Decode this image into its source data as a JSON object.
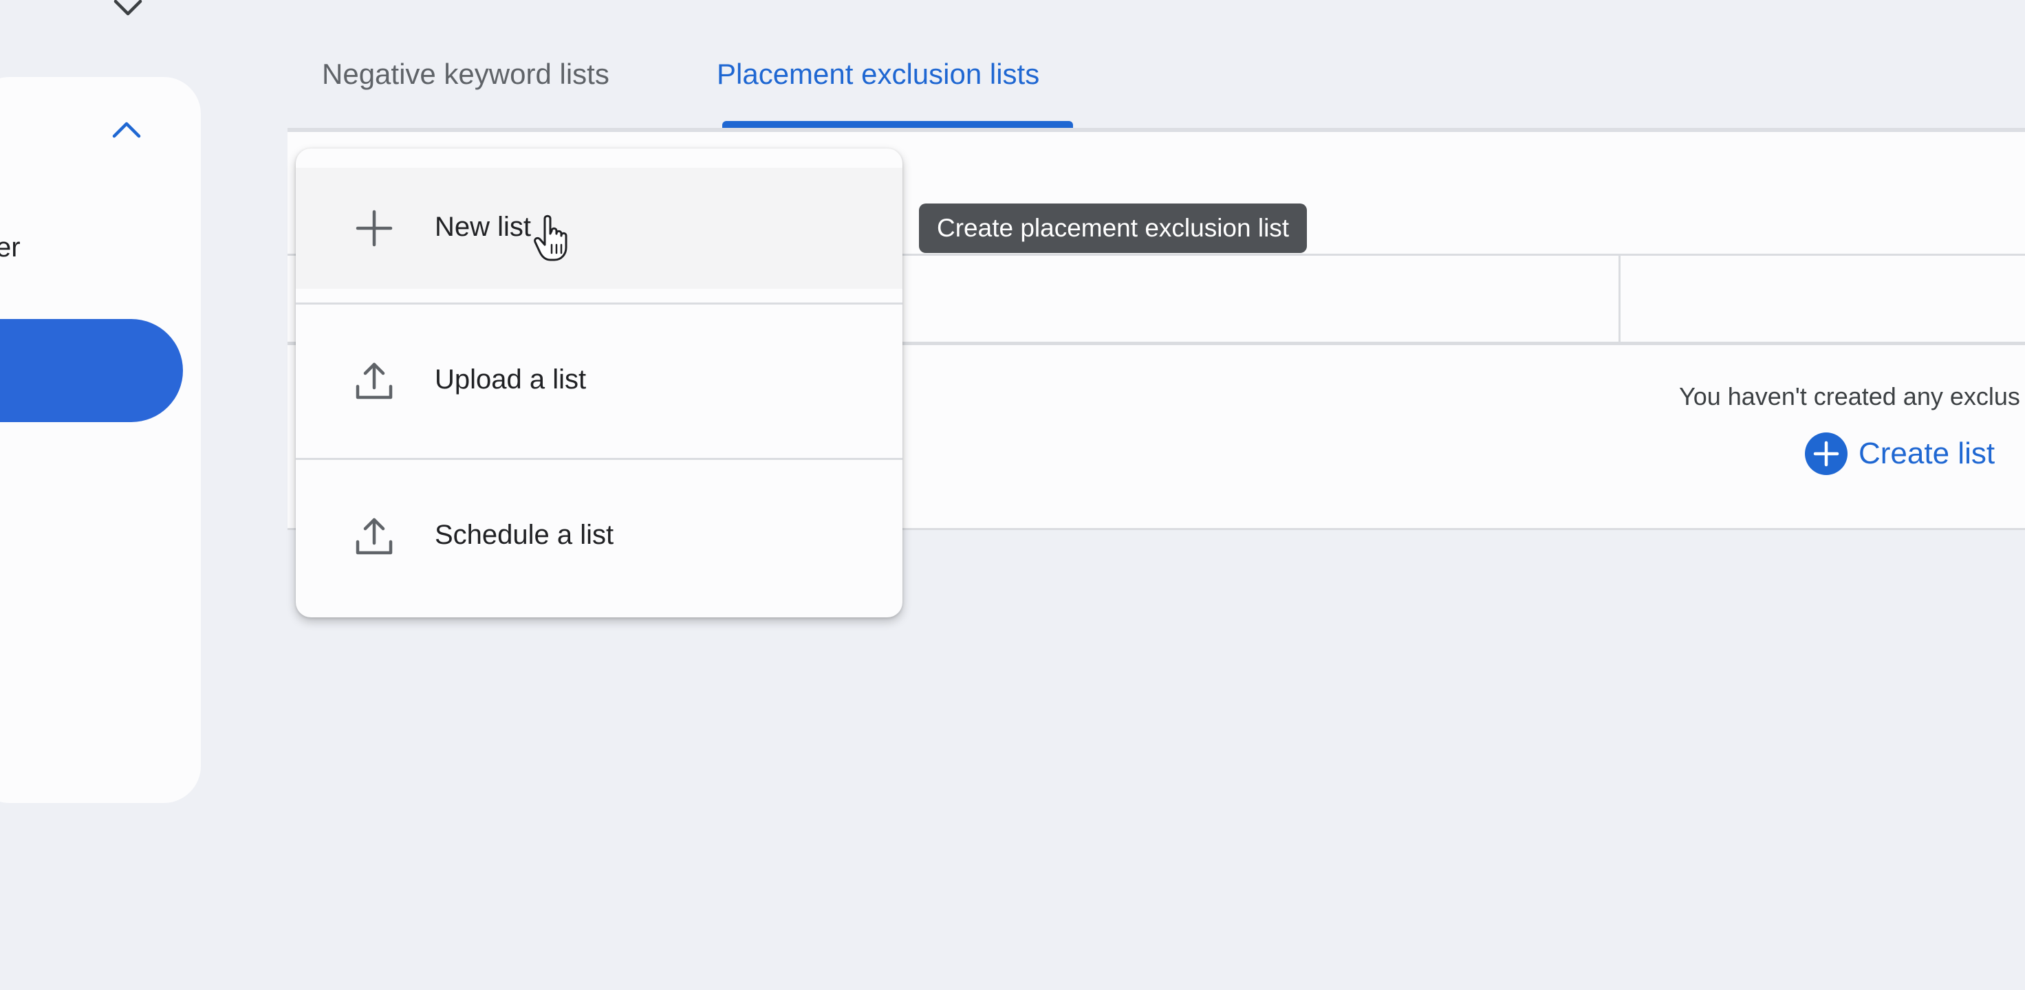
{
  "tabs": {
    "negative_keyword_lists": "Negative keyword lists",
    "placement_exclusion_lists": "Placement exclusion lists",
    "active": "placement_exclusion_lists"
  },
  "sidebar": {
    "partial_text": "er"
  },
  "menu": {
    "items": [
      {
        "label": "New list",
        "icon": "plus-icon"
      },
      {
        "label": "Upload a list",
        "icon": "upload-icon"
      },
      {
        "label": "Schedule a list",
        "icon": "upload-icon"
      }
    ]
  },
  "tooltip": {
    "text": "Create placement exclusion list"
  },
  "empty_state": {
    "message": "You haven't created any exclus",
    "create_button_label": "Create list"
  },
  "colors": {
    "accent_blue": "#1f67d2",
    "page_background": "#eef0f5",
    "tooltip_background": "#4f5256"
  }
}
